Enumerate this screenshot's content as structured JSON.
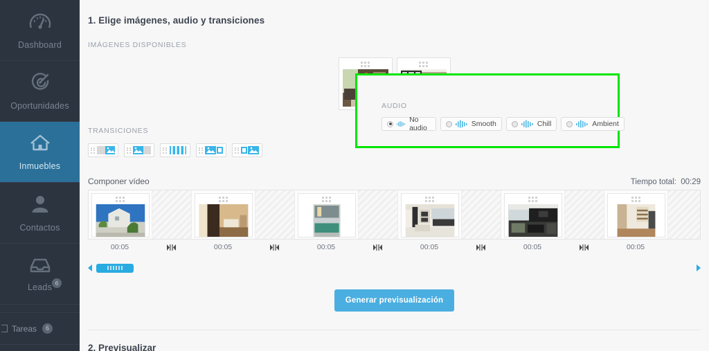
{
  "sidebar": {
    "items": [
      {
        "label": "Dashboard",
        "icon": "gauge-icon",
        "active": false,
        "badge": null
      },
      {
        "label": "Oportunidades",
        "icon": "target-icon",
        "active": false,
        "badge": null
      },
      {
        "label": "Inmuebles",
        "icon": "house-icon",
        "active": true,
        "badge": null
      },
      {
        "label": "Contactos",
        "icon": "person-icon",
        "active": false,
        "badge": null
      },
      {
        "label": "Leads",
        "icon": "inbox-icon",
        "active": false,
        "badge": "6"
      }
    ],
    "tasks": {
      "label": "Tareas",
      "badge": "6",
      "icon": "tasks-icon"
    },
    "active_color": "#2a7099",
    "background_color": "#2c3440"
  },
  "main": {
    "step1_title": "1. Elige imágenes, audio y transiciones",
    "images_label": "IMÁGENES DISPONIBLES",
    "transitions_label": "TRANSICIONES",
    "available_images": [
      {
        "name": "living-room-thumbnail"
      },
      {
        "name": "bedroom-thumbnail"
      }
    ],
    "transitions": [
      {
        "name": "slide-left-transition",
        "selected": false
      },
      {
        "name": "slide-right-transition",
        "selected": false
      },
      {
        "name": "blinds-transition",
        "selected": false
      },
      {
        "name": "shrink-transition",
        "selected": false
      },
      {
        "name": "grow-transition",
        "selected": false
      }
    ],
    "audio": {
      "label": "AUDIO",
      "highlight_color": "#00e500",
      "options": [
        {
          "label": "No audio",
          "selected": true
        },
        {
          "label": "Smooth",
          "selected": false
        },
        {
          "label": "Chill",
          "selected": false
        },
        {
          "label": "Ambient",
          "selected": false
        }
      ]
    },
    "composer": {
      "title": "Componer vídeo",
      "total_label": "Tiempo total:",
      "total_value": "00:29",
      "clips": [
        {
          "name": "villa-exterior-clip",
          "duration": "00:05"
        },
        {
          "name": "bedroom-hall-clip",
          "duration": "00:05"
        },
        {
          "name": "modern-house-clip",
          "duration": "00:05"
        },
        {
          "name": "white-kitchen-clip",
          "duration": "00:05"
        },
        {
          "name": "dark-lounge-clip",
          "duration": "00:05"
        },
        {
          "name": "study-room-clip",
          "duration": "00:05"
        }
      ],
      "split_icon": "split-marker-icon",
      "scroll_left_icon": "arrow-left-icon",
      "scroll_right_icon": "arrow-right-icon"
    },
    "generate_button": "Generar previsualización",
    "step2_title": "2. Previsualizar"
  }
}
